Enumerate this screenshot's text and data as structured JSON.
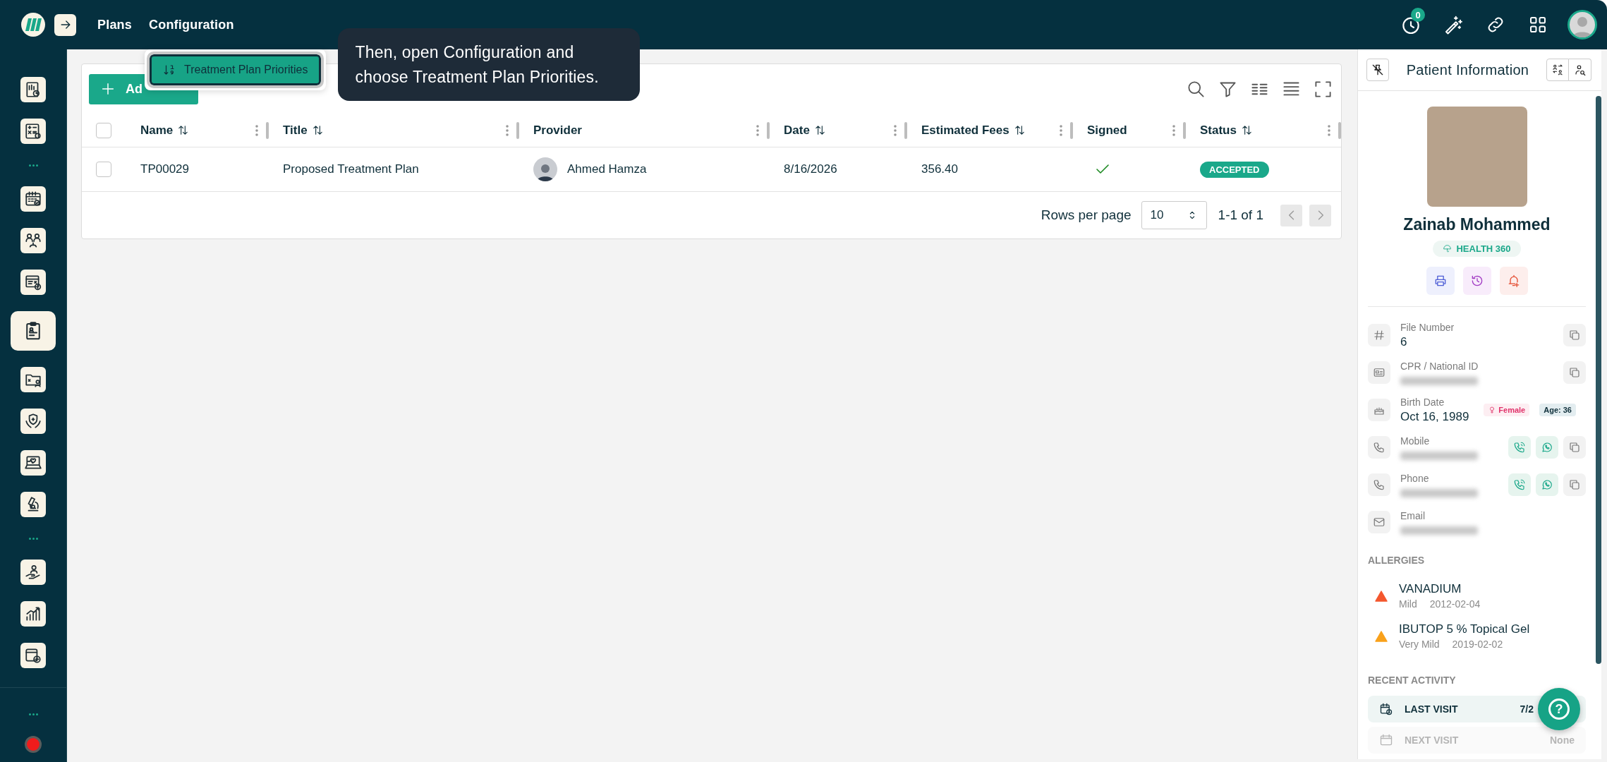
{
  "topbar": {
    "nav": [
      {
        "label": "Plans"
      },
      {
        "label": "Configuration"
      }
    ],
    "notifications_badge": "0"
  },
  "sidebar": {
    "items": [
      {
        "kind": "module",
        "selected": false
      },
      {
        "kind": "module",
        "selected": false
      },
      {
        "kind": "more"
      },
      {
        "kind": "module",
        "selected": false
      },
      {
        "kind": "module",
        "selected": false
      },
      {
        "kind": "module",
        "selected": false
      },
      {
        "kind": "module",
        "selected": true
      },
      {
        "kind": "module",
        "selected": false
      },
      {
        "kind": "module",
        "selected": false
      },
      {
        "kind": "module",
        "selected": false
      },
      {
        "kind": "module",
        "selected": false
      },
      {
        "kind": "more"
      },
      {
        "kind": "module",
        "selected": false
      },
      {
        "kind": "module",
        "selected": false
      },
      {
        "kind": "module",
        "selected": false
      }
    ],
    "footer": [
      {
        "kind": "more"
      },
      {
        "kind": "record"
      }
    ]
  },
  "tour": {
    "menu_item": "Treatment Plan Priorities",
    "tooltip": "Then, open Configuration and choose Treatment Plan Priorities."
  },
  "plans_table": {
    "add_button": "Ad",
    "columns": [
      {
        "label": "Name",
        "sortable": true
      },
      {
        "label": "Title",
        "sortable": true
      },
      {
        "label": "Provider"
      },
      {
        "label": "Date",
        "sortable": true
      },
      {
        "label": "Estimated Fees",
        "sortable": true
      },
      {
        "label": "Signed"
      },
      {
        "label": "Status",
        "sortable": true
      }
    ],
    "header_checked": false,
    "rows": [
      {
        "checked": false,
        "name": "TP00029",
        "title": "Proposed Treatment Plan",
        "provider": "Ahmed Hamza",
        "date": "8/16/2026",
        "estimated_fees": "356.40",
        "signed": true,
        "status": "ACCEPTED"
      }
    ],
    "pagination": {
      "rows_per_page_label": "Rows per page",
      "rows_per_page": "10",
      "range": "1-1 of 1",
      "prev_disabled": true,
      "next_disabled": true
    }
  },
  "patient_panel": {
    "title": "Patient Information",
    "name": "Zainab Mohammed",
    "program": "HEALTH 360",
    "info": [
      {
        "kind": "file",
        "label": "File Number",
        "value": "6",
        "copy": true
      },
      {
        "kind": "id",
        "label": "CPR / National ID",
        "masked": true,
        "copy": true
      },
      {
        "kind": "birth",
        "label": "Birth Date",
        "value": "Oct 16, 1989",
        "gender": "Female",
        "age": "Age: 36"
      },
      {
        "kind": "phone",
        "label": "Mobile",
        "masked": true,
        "call": true,
        "whatsapp": true,
        "copy": true
      },
      {
        "kind": "phone",
        "label": "Phone",
        "masked": true,
        "call": true,
        "whatsapp": true,
        "copy": true
      },
      {
        "kind": "email",
        "label": "Email",
        "masked": true
      }
    ],
    "allergies_heading": "ALLERGIES",
    "allergies": [
      {
        "name": "VANADIUM",
        "severity": "Mild",
        "date": "2012-02-04",
        "color": "#f4572e"
      },
      {
        "name": "IBUTOP 5 % Topical Gel",
        "severity": "Very Mild",
        "date": "2019-02-02",
        "color": "#f9a11b"
      }
    ],
    "activity_heading": "RECENT ACTIVITY",
    "activity": [
      {
        "kind": "last",
        "label": "LAST VISIT",
        "value": "7/2"
      },
      {
        "kind": "next",
        "label": "NEXT VISIT",
        "value": "None"
      }
    ]
  },
  "help_button": {
    "label": "?"
  }
}
